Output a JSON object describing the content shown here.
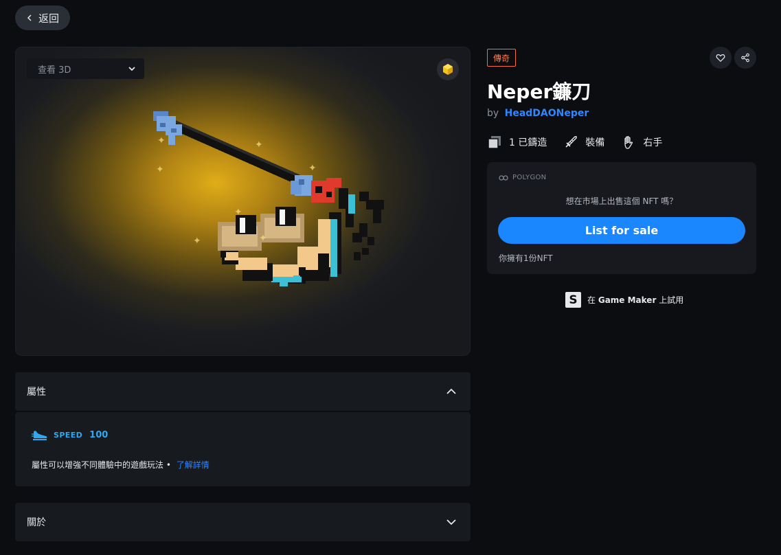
{
  "nav": {
    "back_label": "返回"
  },
  "viewer": {
    "view3d_label": "查看 3D",
    "chain_badge_icon": "polygon-coin-icon",
    "background_glow": "#e0ad18"
  },
  "item": {
    "rarity": "傳奇",
    "rarity_color": "#ff6a3d",
    "name": "Neper鐮刀",
    "by_prefix": "by",
    "creator": "HeadDAONeper",
    "minted": "1 已鑄造",
    "type": "裝備",
    "hand": "右手"
  },
  "sale": {
    "chain": "POLYGON",
    "question": "想在市場上出售這個 NFT 嗎？",
    "list_button": "List for sale",
    "owned": "你擁有1份NFT",
    "accent": "#1a86ff"
  },
  "game_maker": {
    "logo": "S",
    "prefix": "在",
    "name": "Game Maker",
    "suffix": "上試用"
  },
  "attributes": {
    "title": "屬性",
    "stat_name": "SPEED",
    "stat_value": "100",
    "note": "屬性可以增強不同體驗中的遊戲玩法 •",
    "learn_more": "了解詳情"
  },
  "about": {
    "title": "關於"
  }
}
